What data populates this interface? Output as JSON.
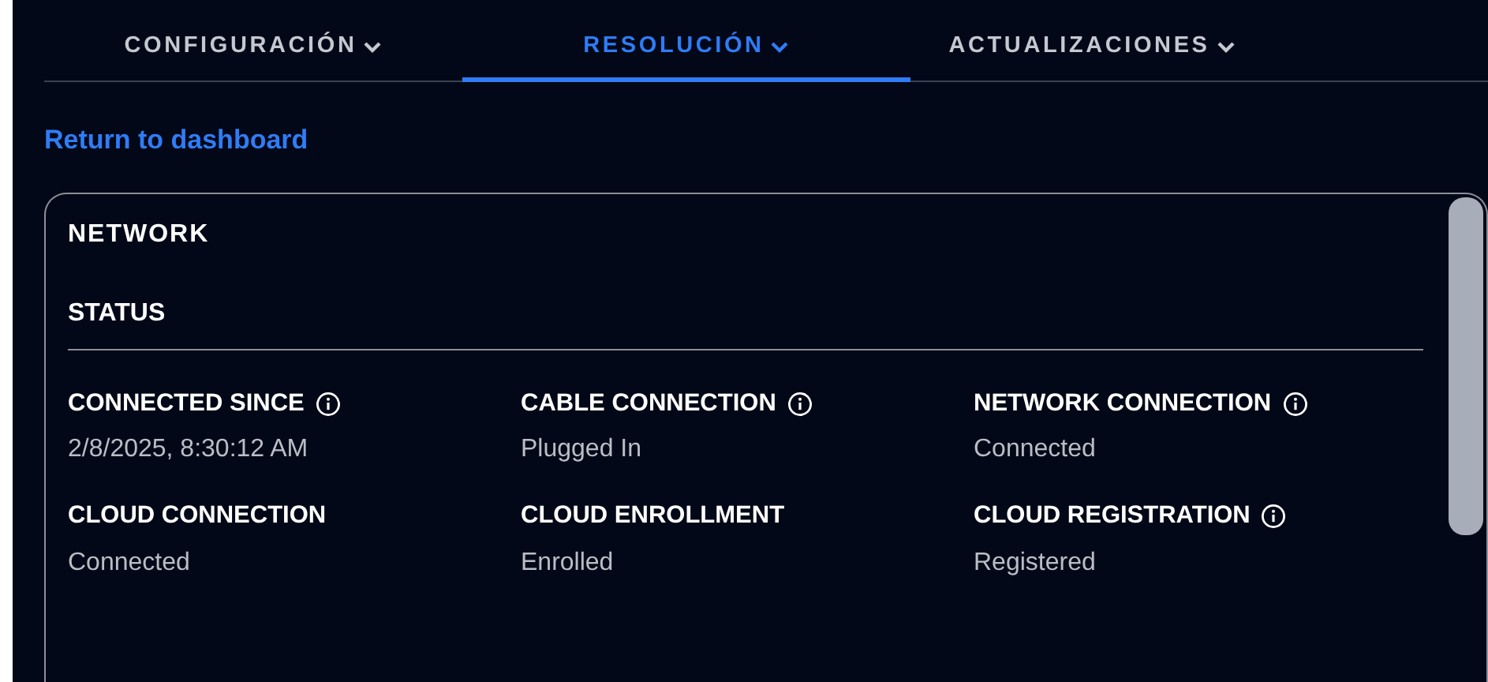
{
  "tabs": [
    {
      "label": "CONFIGURACIÓN",
      "selected": false
    },
    {
      "label": "RESOLUCIÓN",
      "selected": true
    },
    {
      "label": "ACTUALIZACIONES",
      "selected": false
    }
  ],
  "back_link": "Return to dashboard",
  "panel": {
    "title": "NETWORK",
    "section": "STATUS",
    "fields": [
      {
        "label": "CONNECTED SINCE",
        "info": true,
        "value": "2/8/2025, 8:30:12 AM"
      },
      {
        "label": "CABLE CONNECTION",
        "info": true,
        "value": "Plugged In"
      },
      {
        "label": "NETWORK CONNECTION",
        "info": true,
        "value": "Connected"
      },
      {
        "label": "CLOUD CONNECTION",
        "info": false,
        "value": "Connected"
      },
      {
        "label": "CLOUD ENROLLMENT",
        "info": false,
        "value": "Enrolled"
      },
      {
        "label": "CLOUD REGISTRATION",
        "info": true,
        "value": "Registered"
      }
    ]
  }
}
